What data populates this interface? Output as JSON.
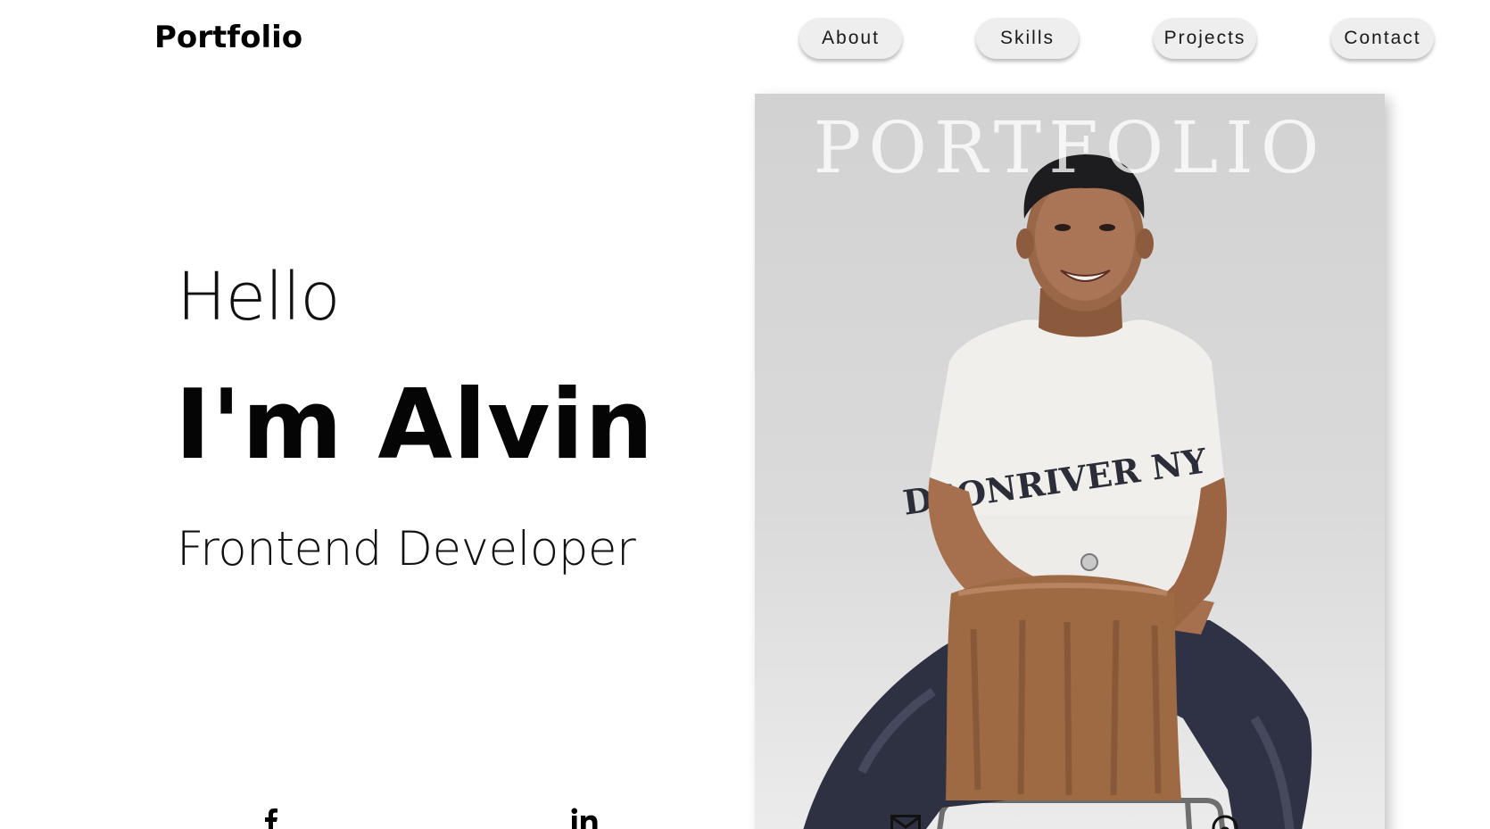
{
  "header": {
    "brand": "Portfolio",
    "nav": [
      {
        "label": "About"
      },
      {
        "label": "Skills"
      },
      {
        "label": "Projects"
      },
      {
        "label": "Contact"
      }
    ]
  },
  "hero": {
    "greeting": "Hello",
    "name": "I'm Alvin",
    "role": "Frontend Developer"
  },
  "portrait_card": {
    "title": "PORTFOLIO",
    "shirt_text": "DSONRIVER NY",
    "alt": "Alvin"
  },
  "social": {
    "facebook_icon": "facebook-icon",
    "linkedin_icon": "linkedin-icon",
    "mail_icon": "mail-icon",
    "github_icon": "github-icon"
  },
  "colors": {
    "background": "#ffffff",
    "nav_button": "#eeeeee",
    "text": "#000000",
    "card_background": "#d6d6d6"
  }
}
